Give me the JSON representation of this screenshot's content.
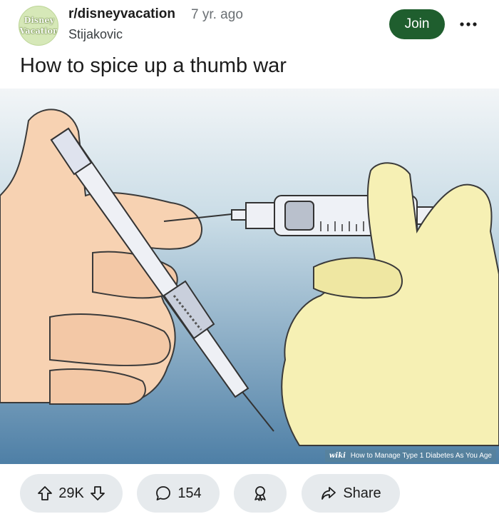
{
  "post": {
    "avatar_line1": "Disney",
    "avatar_line2": "Vacation",
    "subreddit": "r/disneyvacation",
    "age": "7 yr. ago",
    "author": "Stijakovic",
    "join_label": "Join",
    "title": "How to spice up a thumb war"
  },
  "media": {
    "watermark_logo": "wiki",
    "watermark_text": "How to Manage Type 1 Diabetes As You Age"
  },
  "actions": {
    "score": "29K",
    "comments": "154",
    "share_label": "Share"
  },
  "icons": [
    "more-icon",
    "upvote-icon",
    "downvote-icon",
    "comment-icon",
    "award-icon",
    "share-icon"
  ],
  "colors": {
    "join": "#1f5e2e",
    "pill": "#e6eaed",
    "avatar": "#d6e8b8"
  }
}
